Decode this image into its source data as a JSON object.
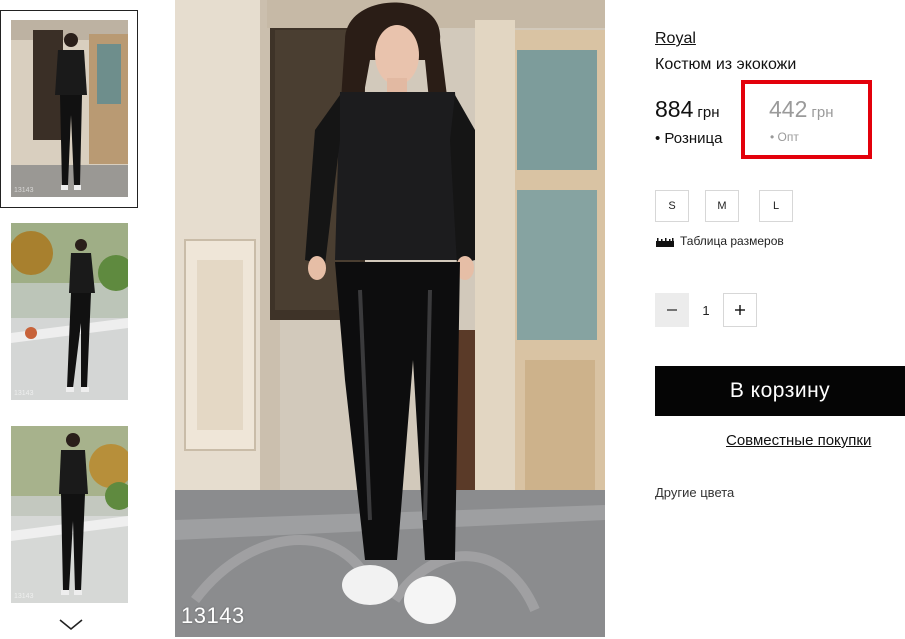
{
  "gallery": {
    "thumbnails": [
      {
        "code": "13143",
        "selected": true
      },
      {
        "code": "13143",
        "selected": false
      },
      {
        "code": "13143",
        "selected": false
      }
    ],
    "scroll_icon": "chevron-down-icon",
    "main_code": "13143"
  },
  "product": {
    "brand": "Royal",
    "name": "Костюм из экокожи",
    "price_retail": {
      "amount": "884",
      "currency": "грн",
      "label": "• Розница"
    },
    "price_wholesale": {
      "amount": "442",
      "currency": "грн",
      "label": "• Опт"
    },
    "sizes": [
      "S",
      "M",
      "L"
    ],
    "size_table_label": "Таблица размеров",
    "size_table_icon": "ruler-icon",
    "quantity": "1",
    "cart_button": "В корзину",
    "joint_purchase_link": "Совместные покупки",
    "other_colors_label": "Другие цвета"
  },
  "colors": {
    "highlight": "#e3000b",
    "cart_bg": "#050505",
    "muted_price": "#9a9a9a"
  }
}
